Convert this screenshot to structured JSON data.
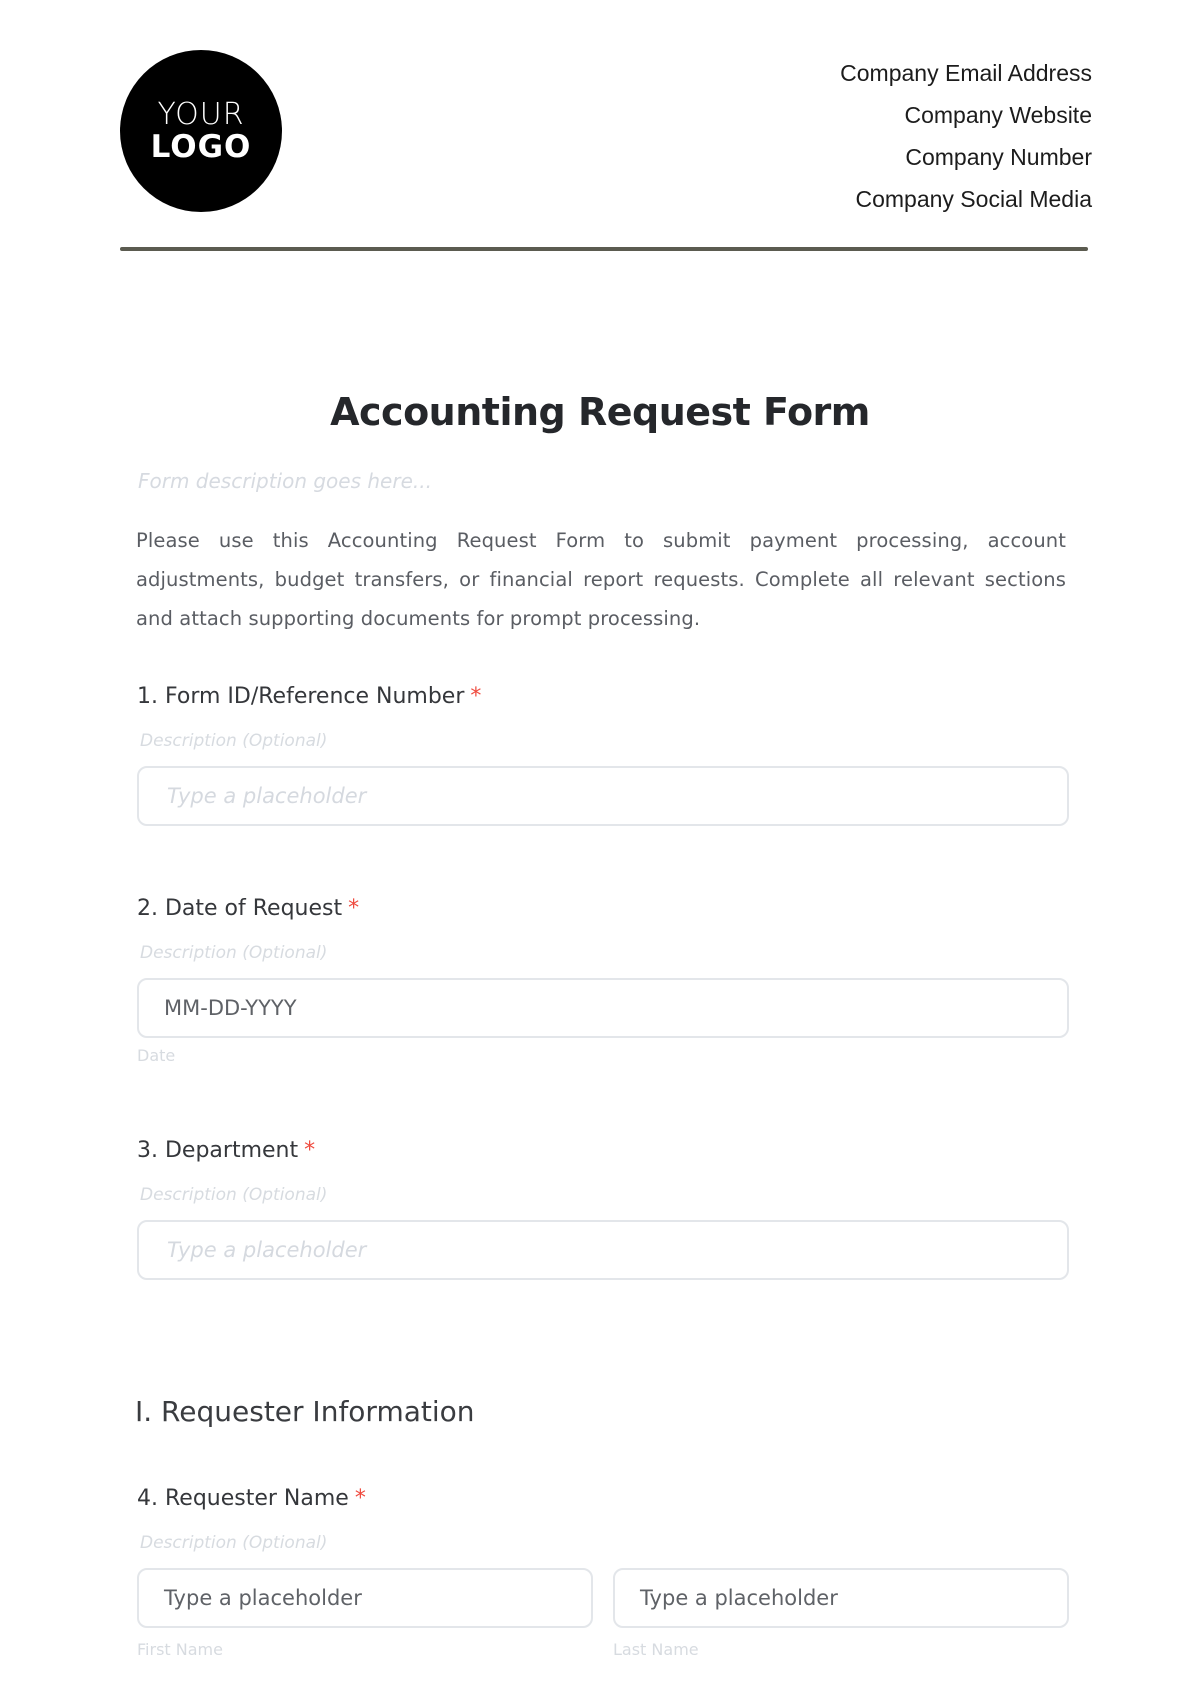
{
  "header": {
    "logo": {
      "line1": "YOUR",
      "line2": "LOGO"
    },
    "company_info": [
      "Company Email Address",
      "Company Website",
      "Company Number",
      "Company Social Media"
    ]
  },
  "form": {
    "title": "Accounting Request Form",
    "description_placeholder": "Form description goes here...",
    "intro": "Please use this Accounting Request Form to submit payment processing, account adjustments, budget transfers, or financial report requests. Complete all relevant sections and attach supporting documents for prompt processing.",
    "required_marker": "*",
    "fields": [
      {
        "label": "1. Form ID/Reference Number",
        "description": "Description (Optional)",
        "placeholder": "Type a placeholder"
      },
      {
        "label": "2. Date of Request",
        "description": "Description (Optional)",
        "placeholder": "MM-DD-YYYY",
        "sub_label": "Date"
      },
      {
        "label": "3. Department",
        "description": "Description (Optional)",
        "placeholder": "Type a placeholder"
      }
    ],
    "sections": [
      {
        "heading": "I. Requester Information",
        "fields": [
          {
            "label": "4. Requester Name",
            "description": "Description (Optional)",
            "first_placeholder": "Type a placeholder",
            "last_placeholder": "Type a placeholder",
            "first_sub_label": "First Name",
            "last_sub_label": "Last Name"
          }
        ]
      }
    ]
  },
  "colors": {
    "required": "#ef4b3f",
    "rule": "#5b5b50",
    "input_border": "#e3e6ea"
  }
}
